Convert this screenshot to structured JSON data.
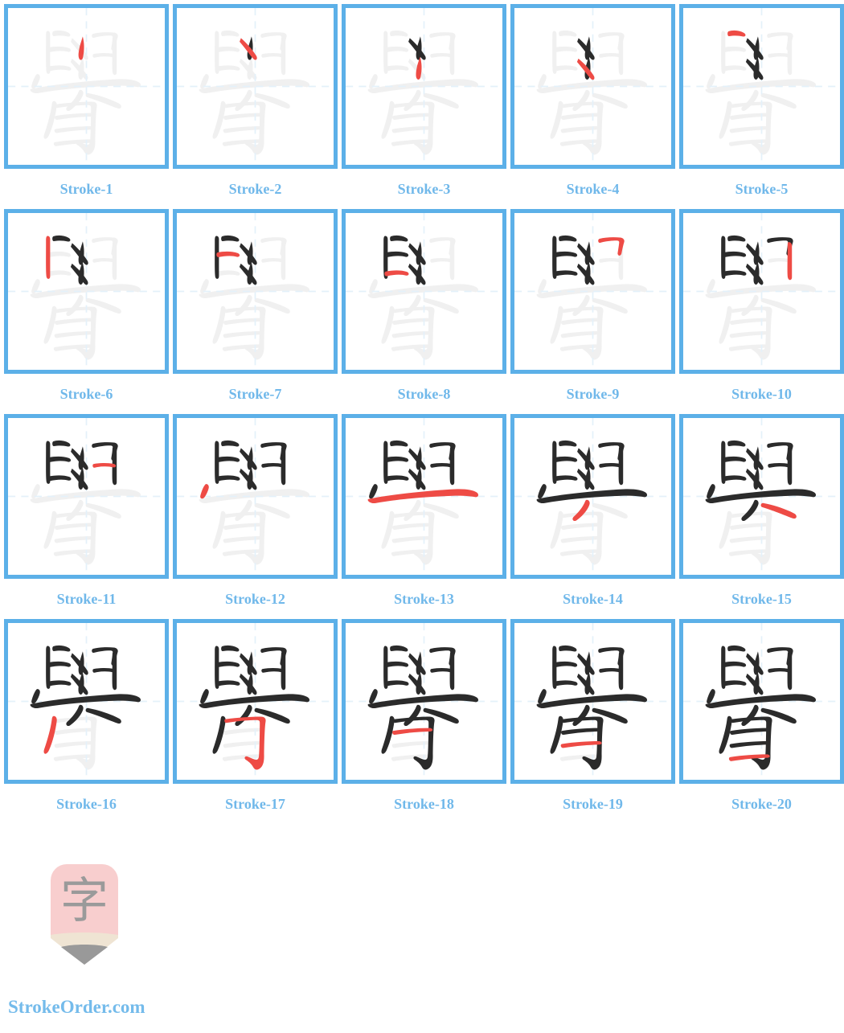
{
  "page": {
    "character": "觷",
    "total_strokes": 20,
    "columns": 5,
    "rows": 4
  },
  "colors": {
    "cell_border": "#5cb0e8",
    "grid_guide": "#e4f1fa",
    "ghost_stroke": "#f0f0f0",
    "completed_stroke": "#2b2b2b",
    "current_stroke": "#ee4b45",
    "label_text": "#70b8ea",
    "site_text": "#74bbeb",
    "logo_body": "#f8cece",
    "logo_wood": "#efe4d3",
    "logo_tip": "#999999",
    "logo_glyph": "#9a9a9a"
  },
  "cells": [
    {
      "index": 1,
      "label": "Stroke-1"
    },
    {
      "index": 2,
      "label": "Stroke-2"
    },
    {
      "index": 3,
      "label": "Stroke-3"
    },
    {
      "index": 4,
      "label": "Stroke-4"
    },
    {
      "index": 5,
      "label": "Stroke-5"
    },
    {
      "index": 6,
      "label": "Stroke-6"
    },
    {
      "index": 7,
      "label": "Stroke-7"
    },
    {
      "index": 8,
      "label": "Stroke-8"
    },
    {
      "index": 9,
      "label": "Stroke-9"
    },
    {
      "index": 10,
      "label": "Stroke-10"
    },
    {
      "index": 11,
      "label": "Stroke-11"
    },
    {
      "index": 12,
      "label": "Stroke-12"
    },
    {
      "index": 13,
      "label": "Stroke-13"
    },
    {
      "index": 14,
      "label": "Stroke-14"
    },
    {
      "index": 15,
      "label": "Stroke-15"
    },
    {
      "index": 16,
      "label": "Stroke-16"
    },
    {
      "index": 17,
      "label": "Stroke-17"
    },
    {
      "index": 18,
      "label": "Stroke-18"
    },
    {
      "index": 19,
      "label": "Stroke-19"
    },
    {
      "index": 20,
      "label": "Stroke-20"
    }
  ],
  "strokes": [
    "M488 186 C498 228 500 268 490 320 C486 342 470 346 463 326 C457 306 462 280 470 244 Z",
    "M419 196 C455 228 492 268 519 312 C531 333 517 348 501 333 C481 313 455 272 410 220 Z",
    "M486 318 C498 360 500 398 490 448 C485 470 469 474 462 455 C456 436 461 410 468 375 Z",
    "M418 330 C454 360 491 398 518 442 C530 463 516 478 500 463 C480 443 454 404 409 352 Z",
    "M296 152 C330 142 366 146 396 162 C414 172 408 190 389 186 C364 180 334 178 300 184 C288 186 286 156 296 152 Z",
    "M256 150 C266 148 275 156 275 170 L275 415 C275 432 258 436 252 420 C246 400 248 300 248 180 C248 162 250 152 256 150 Z",
    "M266 258 C316 248 362 250 398 262 C418 270 412 290 392 286 C362 278 322 278 272 288 C258 291 254 261 266 258 Z",
    "M262 382 C314 372 362 372 400 384 C420 392 414 412 394 408 C364 400 322 400 270 412 C254 416 248 386 262 382 Z",
    "M556 168 C596 158 646 156 690 160 C712 162 722 176 716 192 C710 212 704 238 700 262 C696 282 676 284 674 264 C678 240 682 214 684 196 C686 184 680 180 666 180 C630 180 590 186 560 194 C546 198 542 172 556 168 Z",
    "M690 190 C702 190 710 200 710 216 L710 420 C710 440 690 444 684 424 C678 404 682 300 682 214 C682 198 682 190 690 190 Z",
    "M560 300 C606 292 652 292 692 300 C712 306 706 326 686 322 C654 314 614 314 566 324 C552 327 548 303 560 300 Z",
    "M188 432 C200 428 212 440 208 458 C204 476 194 498 182 516 C170 534 148 528 154 506 C160 484 172 448 188 432 Z",
    "M148 530 C232 510 440 482 686 466 C774 460 830 468 856 486 C874 498 868 520 846 516 C810 510 766 506 700 508 C520 514 340 530 196 556 C160 562 136 536 148 530 Z",
    "M472 534 C486 534 496 548 490 566 C480 598 446 640 406 668 C386 682 370 660 388 644 C424 612 452 572 462 544 C466 536 468 534 472 534 Z",
    "M524 556 C598 570 674 596 726 624 C748 636 742 662 718 656 C686 646 606 610 516 582 C500 577 508 552 524 556 Z",
    "M300 608 C312 608 322 622 318 644 C310 700 294 772 268 830 C252 866 226 860 236 826 C258 762 278 692 286 632 C288 614 292 608 300 608 Z",
    "M318 628 C398 618 486 612 548 612 C572 612 584 624 580 644 C574 676 570 790 570 870 C570 910 562 938 540 952 C522 964 508 958 498 940 C490 924 474 908 452 894 C436 884 444 866 460 872 C480 880 496 888 510 892 C526 896 534 890 536 872 C540 840 542 700 542 652 C542 638 536 634 520 634 C470 634 398 640 326 652 C310 655 306 630 318 628 Z",
    "M312 704 C392 692 478 686 548 686 C570 686 576 706 554 708 C482 710 404 716 322 730 C306 733 298 707 312 704 Z",
    "M310 790 C390 778 478 772 550 772 C572 772 578 792 556 794 C484 796 404 802 320 816 C304 819 296 793 310 790 Z",
    "M306 876 C386 864 474 858 546 858 C568 858 574 878 552 880 C480 882 400 888 316 902 C300 905 292 879 306 876 Z"
  ],
  "footer": {
    "logo_glyph": "字",
    "site_name": "StrokeOrder.com"
  }
}
